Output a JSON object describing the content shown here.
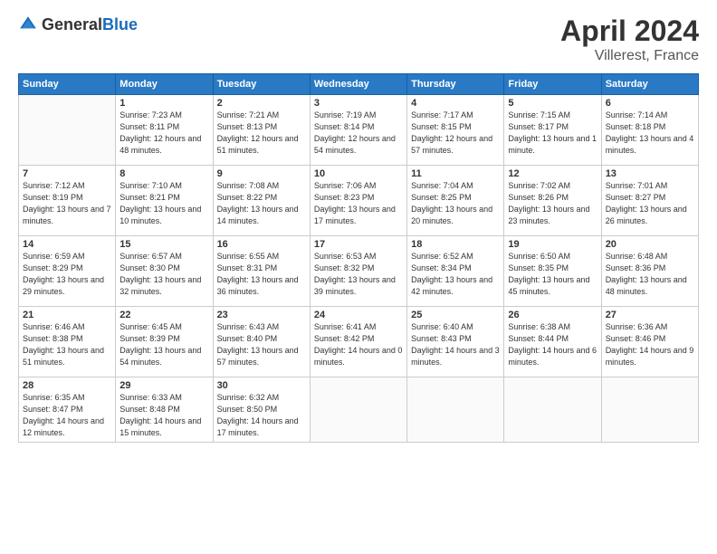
{
  "header": {
    "logo_general": "General",
    "logo_blue": "Blue",
    "month": "April 2024",
    "location": "Villerest, France"
  },
  "days_of_week": [
    "Sunday",
    "Monday",
    "Tuesday",
    "Wednesday",
    "Thursday",
    "Friday",
    "Saturday"
  ],
  "weeks": [
    [
      {
        "day": "",
        "sunrise": "",
        "sunset": "",
        "daylight": ""
      },
      {
        "day": "1",
        "sunrise": "7:23 AM",
        "sunset": "8:11 PM",
        "daylight": "12 hours and 48 minutes."
      },
      {
        "day": "2",
        "sunrise": "7:21 AM",
        "sunset": "8:13 PM",
        "daylight": "12 hours and 51 minutes."
      },
      {
        "day": "3",
        "sunrise": "7:19 AM",
        "sunset": "8:14 PM",
        "daylight": "12 hours and 54 minutes."
      },
      {
        "day": "4",
        "sunrise": "7:17 AM",
        "sunset": "8:15 PM",
        "daylight": "12 hours and 57 minutes."
      },
      {
        "day": "5",
        "sunrise": "7:15 AM",
        "sunset": "8:17 PM",
        "daylight": "13 hours and 1 minute."
      },
      {
        "day": "6",
        "sunrise": "7:14 AM",
        "sunset": "8:18 PM",
        "daylight": "13 hours and 4 minutes."
      }
    ],
    [
      {
        "day": "7",
        "sunrise": "7:12 AM",
        "sunset": "8:19 PM",
        "daylight": "13 hours and 7 minutes."
      },
      {
        "day": "8",
        "sunrise": "7:10 AM",
        "sunset": "8:21 PM",
        "daylight": "13 hours and 10 minutes."
      },
      {
        "day": "9",
        "sunrise": "7:08 AM",
        "sunset": "8:22 PM",
        "daylight": "13 hours and 14 minutes."
      },
      {
        "day": "10",
        "sunrise": "7:06 AM",
        "sunset": "8:23 PM",
        "daylight": "13 hours and 17 minutes."
      },
      {
        "day": "11",
        "sunrise": "7:04 AM",
        "sunset": "8:25 PM",
        "daylight": "13 hours and 20 minutes."
      },
      {
        "day": "12",
        "sunrise": "7:02 AM",
        "sunset": "8:26 PM",
        "daylight": "13 hours and 23 minutes."
      },
      {
        "day": "13",
        "sunrise": "7:01 AM",
        "sunset": "8:27 PM",
        "daylight": "13 hours and 26 minutes."
      }
    ],
    [
      {
        "day": "14",
        "sunrise": "6:59 AM",
        "sunset": "8:29 PM",
        "daylight": "13 hours and 29 minutes."
      },
      {
        "day": "15",
        "sunrise": "6:57 AM",
        "sunset": "8:30 PM",
        "daylight": "13 hours and 32 minutes."
      },
      {
        "day": "16",
        "sunrise": "6:55 AM",
        "sunset": "8:31 PM",
        "daylight": "13 hours and 36 minutes."
      },
      {
        "day": "17",
        "sunrise": "6:53 AM",
        "sunset": "8:32 PM",
        "daylight": "13 hours and 39 minutes."
      },
      {
        "day": "18",
        "sunrise": "6:52 AM",
        "sunset": "8:34 PM",
        "daylight": "13 hours and 42 minutes."
      },
      {
        "day": "19",
        "sunrise": "6:50 AM",
        "sunset": "8:35 PM",
        "daylight": "13 hours and 45 minutes."
      },
      {
        "day": "20",
        "sunrise": "6:48 AM",
        "sunset": "8:36 PM",
        "daylight": "13 hours and 48 minutes."
      }
    ],
    [
      {
        "day": "21",
        "sunrise": "6:46 AM",
        "sunset": "8:38 PM",
        "daylight": "13 hours and 51 minutes."
      },
      {
        "day": "22",
        "sunrise": "6:45 AM",
        "sunset": "8:39 PM",
        "daylight": "13 hours and 54 minutes."
      },
      {
        "day": "23",
        "sunrise": "6:43 AM",
        "sunset": "8:40 PM",
        "daylight": "13 hours and 57 minutes."
      },
      {
        "day": "24",
        "sunrise": "6:41 AM",
        "sunset": "8:42 PM",
        "daylight": "14 hours and 0 minutes."
      },
      {
        "day": "25",
        "sunrise": "6:40 AM",
        "sunset": "8:43 PM",
        "daylight": "14 hours and 3 minutes."
      },
      {
        "day": "26",
        "sunrise": "6:38 AM",
        "sunset": "8:44 PM",
        "daylight": "14 hours and 6 minutes."
      },
      {
        "day": "27",
        "sunrise": "6:36 AM",
        "sunset": "8:46 PM",
        "daylight": "14 hours and 9 minutes."
      }
    ],
    [
      {
        "day": "28",
        "sunrise": "6:35 AM",
        "sunset": "8:47 PM",
        "daylight": "14 hours and 12 minutes."
      },
      {
        "day": "29",
        "sunrise": "6:33 AM",
        "sunset": "8:48 PM",
        "daylight": "14 hours and 15 minutes."
      },
      {
        "day": "30",
        "sunrise": "6:32 AM",
        "sunset": "8:50 PM",
        "daylight": "14 hours and 17 minutes."
      },
      {
        "day": "",
        "sunrise": "",
        "sunset": "",
        "daylight": ""
      },
      {
        "day": "",
        "sunrise": "",
        "sunset": "",
        "daylight": ""
      },
      {
        "day": "",
        "sunrise": "",
        "sunset": "",
        "daylight": ""
      },
      {
        "day": "",
        "sunrise": "",
        "sunset": "",
        "daylight": ""
      }
    ]
  ]
}
